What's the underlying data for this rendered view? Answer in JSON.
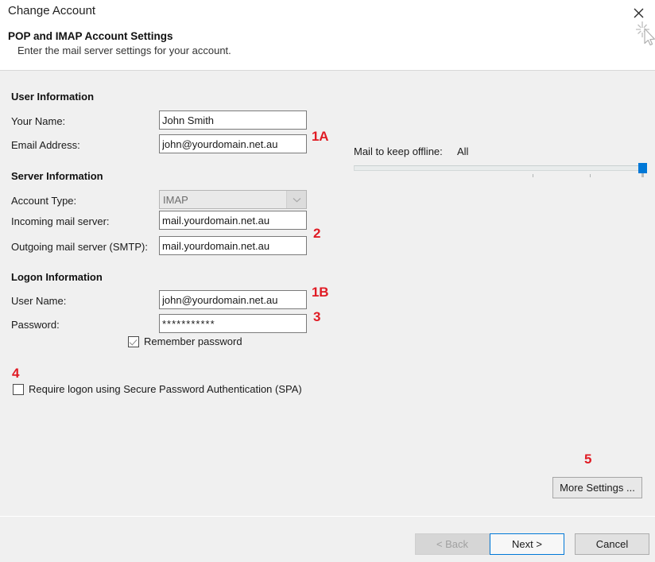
{
  "window": {
    "title": "Change Account",
    "close_icon": "close-icon",
    "cursor_icon": "busy-pointer-cursor"
  },
  "header": {
    "heading": "POP and IMAP Account Settings",
    "subheading": "Enter the mail server settings for your account."
  },
  "sections": {
    "user_information": {
      "title": "User Information",
      "fields": [
        {
          "label": "Your Name:",
          "value": "John Smith"
        },
        {
          "label": "Email Address:",
          "value": "john@yourdomain.net.au"
        }
      ]
    },
    "server_information": {
      "title": "Server Information",
      "account_type": {
        "label": "Account Type:",
        "value": "IMAP",
        "arrow_icon": "chevron-down-icon",
        "disabled": true
      },
      "fields": [
        {
          "label": "Incoming mail server:",
          "value": "mail.yourdomain.net.au"
        },
        {
          "label": "Outgoing mail server (SMTP):",
          "value": "mail.yourdomain.net.au"
        }
      ]
    },
    "logon_information": {
      "title": "Logon Information",
      "fields": [
        {
          "label": "User Name:",
          "value": "john@yourdomain.net.au"
        },
        {
          "label": "Password:",
          "value": "***********"
        }
      ],
      "remember_password": {
        "label": "Remember password",
        "checked": true
      },
      "spa": {
        "label": "Require logon using Secure Password Authentication (SPA)",
        "checked": false
      }
    }
  },
  "offline": {
    "label": "Mail to keep offline:",
    "value": "All",
    "slider": {
      "min": 0,
      "max": 100,
      "current": 100
    }
  },
  "buttons": {
    "more_settings": "More Settings ...",
    "back": "< Back",
    "next": "Next >",
    "cancel": "Cancel"
  },
  "annotations": [
    {
      "id": "1A",
      "text": "1A"
    },
    {
      "id": "2",
      "text": "2"
    },
    {
      "id": "1B",
      "text": "1B"
    },
    {
      "id": "3",
      "text": "3"
    },
    {
      "id": "4",
      "text": "4"
    },
    {
      "id": "5",
      "text": "5"
    }
  ],
  "colors": {
    "annotation_red": "#e01b24",
    "accent_blue": "#0078d7",
    "dialog_bg": "#f0f0f0",
    "header_bg": "#ffffff"
  }
}
